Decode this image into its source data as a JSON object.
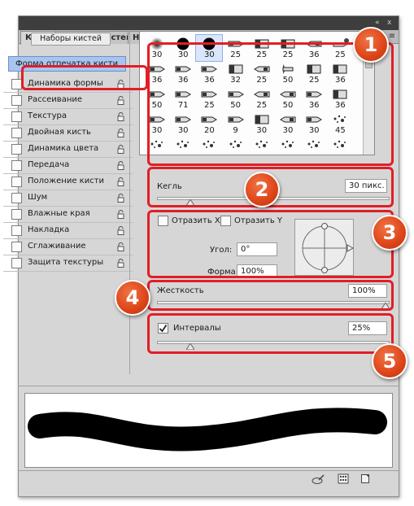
{
  "tabs": [
    {
      "label": "Кисть",
      "active": true
    },
    {
      "label": "Наборы кистей",
      "active": false
    },
    {
      "label": "Наб.инстр",
      "active": false
    }
  ],
  "topbar": {
    "collapse_glyph": "«",
    "close_glyph": "x",
    "menu_glyph": "≡"
  },
  "left": {
    "presets_button": "Наборы кистей",
    "tip_shape": "Форма отпечатка кисти",
    "options": [
      {
        "label": "Динамика формы",
        "checked": false,
        "locked": true
      },
      {
        "label": "Рассеивание",
        "checked": false,
        "locked": true
      },
      {
        "label": "Текстура",
        "checked": false,
        "locked": true
      },
      {
        "label": "Двойная кисть",
        "checked": false,
        "locked": true
      },
      {
        "label": "Динамика цвета",
        "checked": false,
        "locked": true
      },
      {
        "label": "Передача",
        "checked": false,
        "locked": true
      },
      {
        "label": "Положение кисти",
        "checked": false,
        "locked": true
      },
      {
        "label": "Шум",
        "checked": false,
        "locked": true
      },
      {
        "label": "Влажные края",
        "checked": false,
        "locked": true
      },
      {
        "label": "Накладка",
        "checked": false,
        "locked": true
      },
      {
        "label": "Сглаживание",
        "checked": false,
        "locked": true
      },
      {
        "label": "Защита текстуры",
        "checked": false,
        "locked": true
      }
    ]
  },
  "brush_grid": {
    "selected_index": 2,
    "sizes": [
      "30",
      "30",
      "30",
      "25",
      "25",
      "25",
      "36",
      "25",
      "36",
      "36",
      "36",
      "32",
      "25",
      "50",
      "25",
      "36",
      "50",
      "71",
      "25",
      "50",
      "25",
      "50",
      "36",
      "36",
      "30",
      "30",
      "20",
      "9",
      "30",
      "30",
      "30",
      "45",
      "",
      "",
      "",
      "",
      "",
      "",
      "",
      ""
    ],
    "tips": [
      "soft-round",
      "hard-round",
      "hard-round",
      "chisel",
      "flat-square",
      "flat-square",
      "chisel-left",
      "chisel-blot",
      "chisel",
      "chisel",
      "chisel",
      "flat-square",
      "chisel-left",
      "fan",
      "flat-square",
      "flat-square",
      "chisel",
      "chisel",
      "chisel",
      "chisel",
      "chisel-left",
      "chisel-left",
      "chisel",
      "flat-square",
      "chisel",
      "chisel",
      "chisel",
      "chisel",
      "flat-square",
      "chisel-left",
      "chisel",
      "spatter",
      "spatter",
      "spatter",
      "spatter",
      "spatter",
      "spatter",
      "spatter",
      "spatter",
      "spatter"
    ]
  },
  "size": {
    "label": "Кегль",
    "value": "30 пикс."
  },
  "flip": {
    "flip_x_label": "Отразить X",
    "flip_y_label": "Отразить Y",
    "flip_x": false,
    "flip_y": false
  },
  "angle": {
    "label": "Угол:",
    "value": "0°"
  },
  "roundness": {
    "label": "Форма:",
    "value": "100%"
  },
  "hardness": {
    "label": "Жесткость",
    "value": "100%",
    "fraction": 1.0
  },
  "spacing": {
    "label": "Интервалы",
    "value": "25%",
    "checked": true,
    "fraction": 0.13
  },
  "callouts": [
    "1",
    "2",
    "3",
    "4",
    "5"
  ],
  "colors": {
    "callout": "#e11e26",
    "badge": "#dd4418",
    "selected": "#a9c5ef"
  }
}
